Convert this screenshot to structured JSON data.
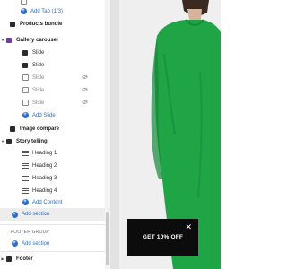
{
  "sidebar": {
    "top_items": [
      {
        "label": "Add Tab (1/3)"
      }
    ],
    "products_bundle": "Products bundle",
    "gallery_carousel": {
      "title": "Gallery carousel",
      "slides": [
        "Slide",
        "Slide",
        "Slide",
        "Slide",
        "Slide"
      ],
      "add_label": "Add Slide"
    },
    "image_compare": "Image compare",
    "story_telling": {
      "title": "Story telling",
      "headings": [
        "Heading 1",
        "Heading 2",
        "Heading 3",
        "Heading 4"
      ],
      "add_label": "Add Content"
    },
    "add_section": "Add section",
    "footer_group": {
      "label": "FOOTER GROUP",
      "add_section": "Add section",
      "footer": "Footer"
    }
  },
  "preview": {
    "banner_text": "GET 10% OFF",
    "close_symbol": "✕"
  },
  "colors": {
    "accent": "#2c6ecb",
    "gallery_icon": "#6b3fa0",
    "model_dress": "#1fa446",
    "banner_bg": "#0c0c0c"
  }
}
